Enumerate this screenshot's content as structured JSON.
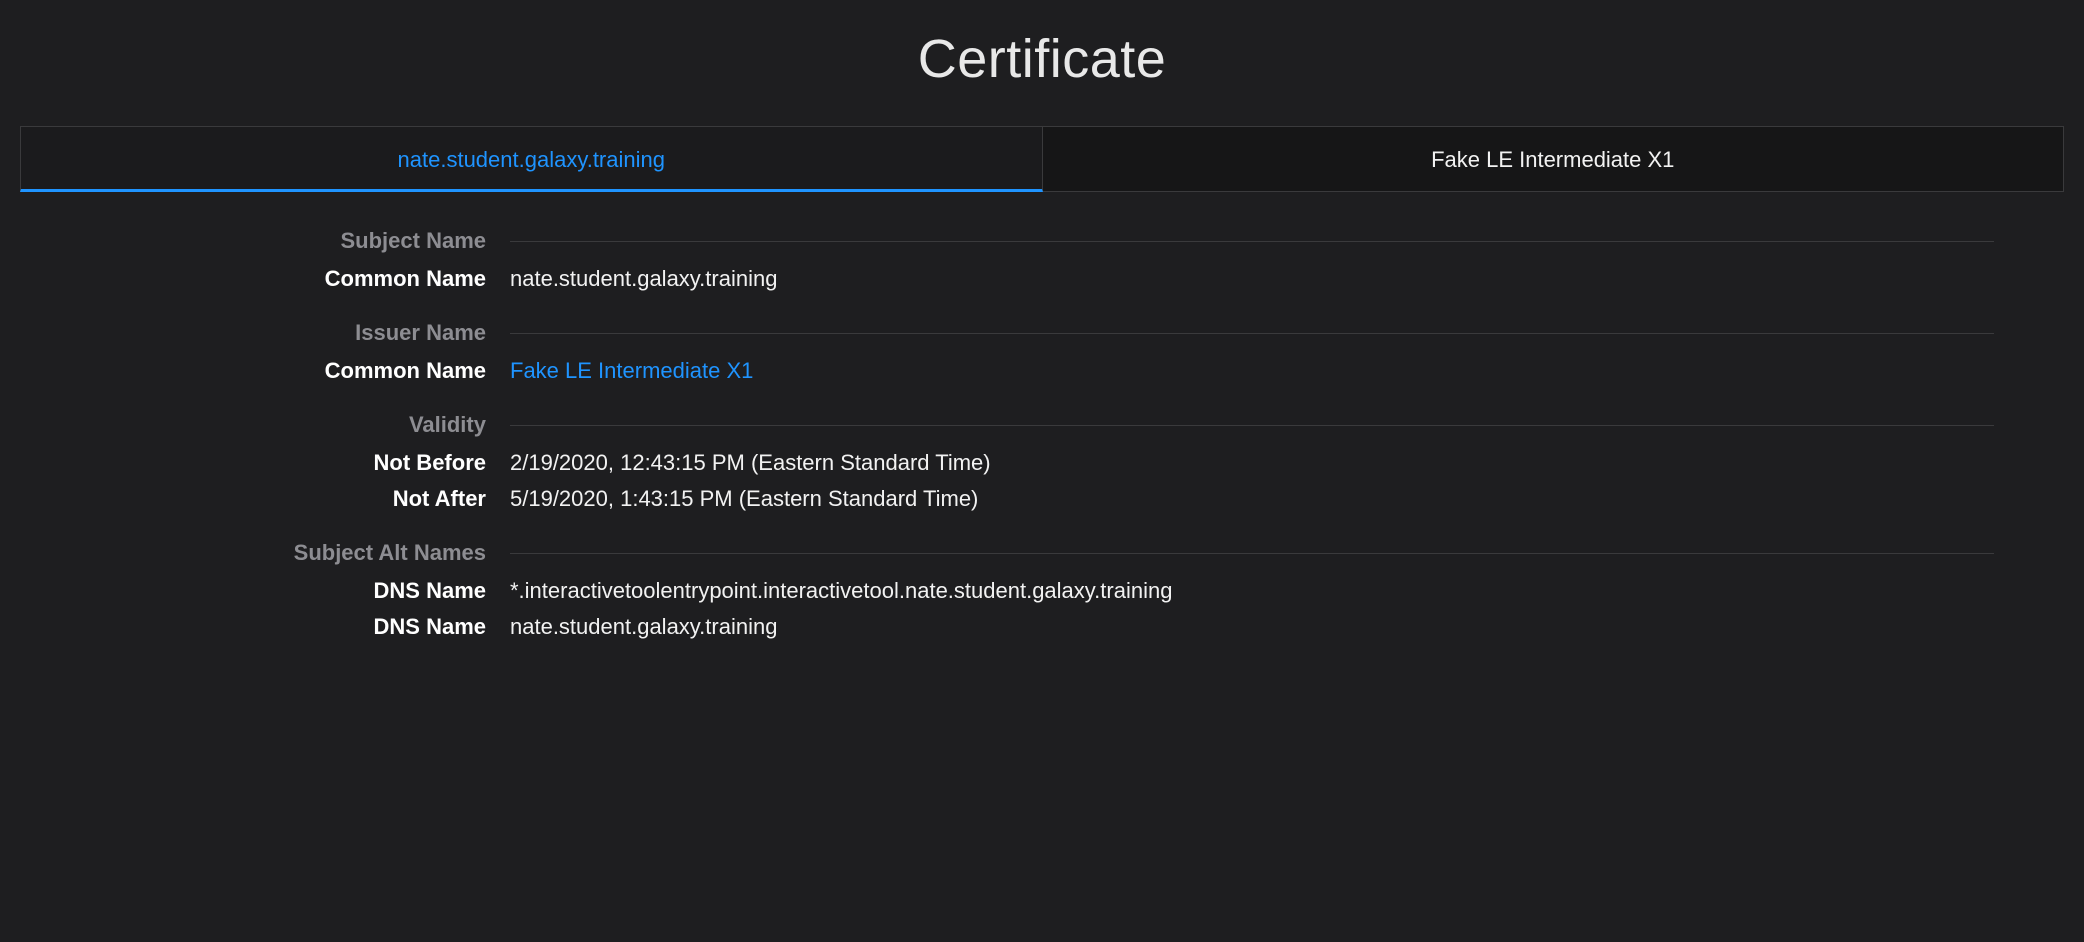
{
  "title": "Certificate",
  "tabs": [
    {
      "label": "nate.student.galaxy.training",
      "active": true
    },
    {
      "label": "Fake LE Intermediate X1",
      "active": false
    }
  ],
  "sections": {
    "subject_name": {
      "header": "Subject Name",
      "common_name_label": "Common Name",
      "common_name_value": "nate.student.galaxy.training"
    },
    "issuer_name": {
      "header": "Issuer Name",
      "common_name_label": "Common Name",
      "common_name_value": "Fake LE Intermediate X1"
    },
    "validity": {
      "header": "Validity",
      "not_before_label": "Not Before",
      "not_before_value": "2/19/2020, 12:43:15 PM (Eastern Standard Time)",
      "not_after_label": "Not After",
      "not_after_value": "5/19/2020, 1:43:15 PM (Eastern Standard Time)"
    },
    "san": {
      "header": "Subject Alt Names",
      "dns_label": "DNS Name",
      "dns1": "*.interactivetoolentrypoint.interactivetool.nate.student.galaxy.training",
      "dns2": "nate.student.galaxy.training"
    }
  }
}
